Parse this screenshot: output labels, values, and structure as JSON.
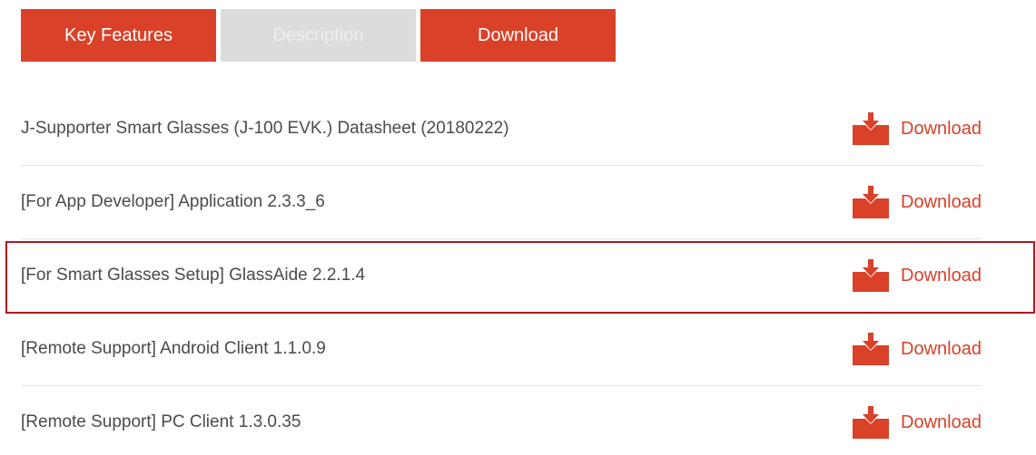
{
  "tabs": [
    {
      "label": "Key Features",
      "active": true
    },
    {
      "label": "Description",
      "active": false
    },
    {
      "label": "Download",
      "active": true
    }
  ],
  "downloads": [
    {
      "title": "J-Supporter Smart Glasses (J-100 EVK.) Datasheet (20180222)",
      "action": "Download",
      "icon": "download-tray-icon"
    },
    {
      "title": "[For App Developer] Application 2.3.3_6",
      "action": "Download",
      "icon": "download-tray-icon"
    },
    {
      "title": "[For Smart Glasses Setup] GlassAide 2.2.1.4",
      "action": "Download",
      "icon": "download-tray-icon"
    },
    {
      "title": "[Remote Support] Android Client 1.1.0.9",
      "action": "Download",
      "icon": "download-tray-icon"
    },
    {
      "title": "[Remote Support] PC Client 1.3.0.35",
      "action": "Download",
      "icon": "download-tray-icon"
    }
  ],
  "highlighted_index": 2,
  "colors": {
    "accent": "#d94128",
    "inactive_tab": "#dcdcdc",
    "highlight_border": "#b2171e",
    "text": "#4b4b4b"
  }
}
